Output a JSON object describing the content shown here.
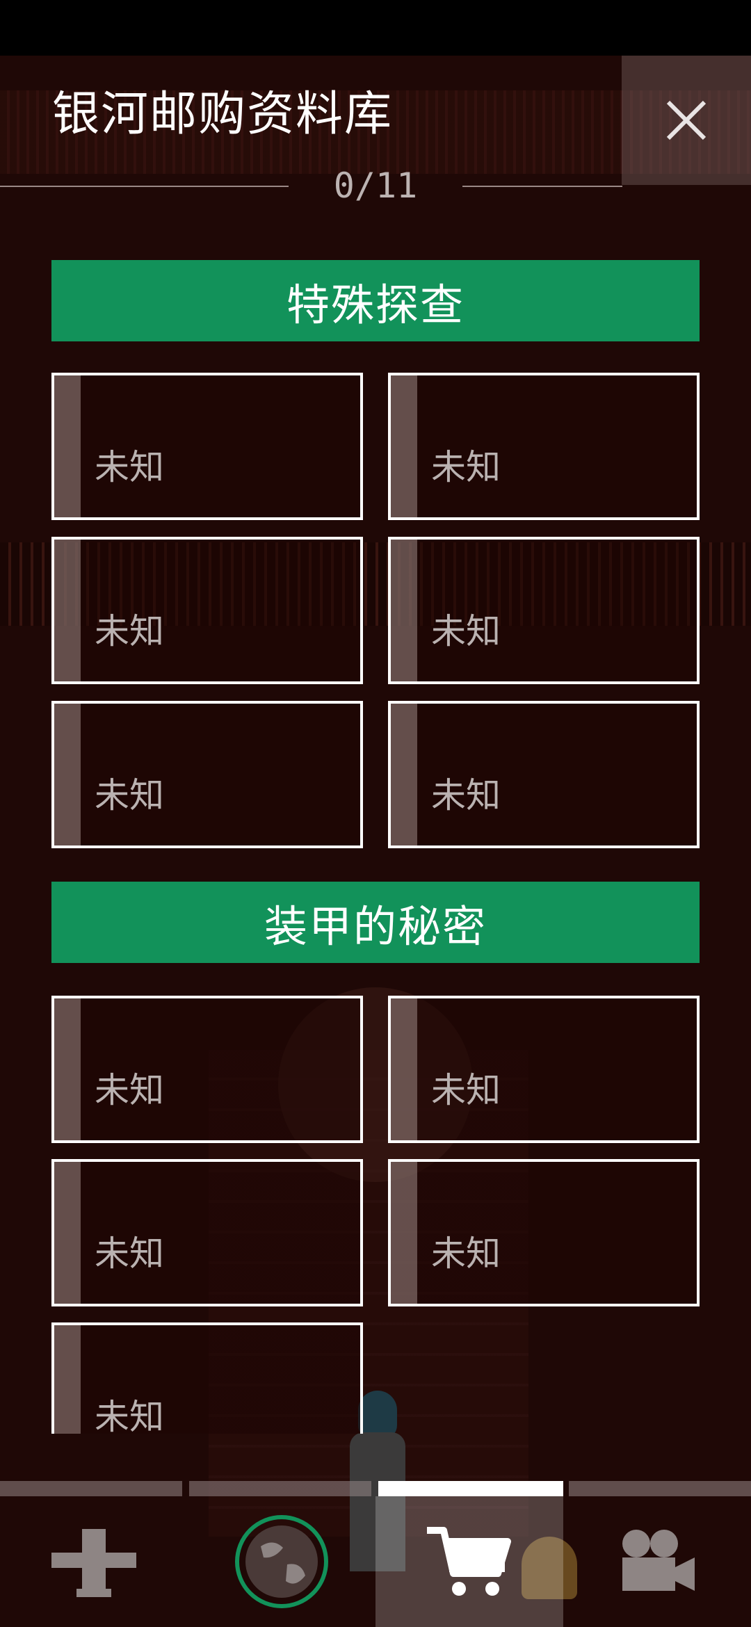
{
  "header": {
    "title": "银河邮购资料库",
    "progress": "0/11"
  },
  "sections": [
    {
      "title": "特殊探查",
      "entries": [
        "未知",
        "未知",
        "未知",
        "未知",
        "未知",
        "未知"
      ]
    },
    {
      "title": "装甲的秘密",
      "entries": [
        "未知",
        "未知",
        "未知",
        "未知",
        "未知"
      ]
    }
  ],
  "nav": {
    "tabs": [
      {
        "icon": "tools-icon",
        "active": false
      },
      {
        "icon": "planet-icon",
        "active": false
      },
      {
        "icon": "shopping-cart-icon",
        "active": true
      },
      {
        "icon": "video-camera-icon",
        "active": false
      }
    ]
  },
  "colors": {
    "section_header": "#12925a",
    "background": "#1f0806",
    "card_border": "#ffffff"
  }
}
